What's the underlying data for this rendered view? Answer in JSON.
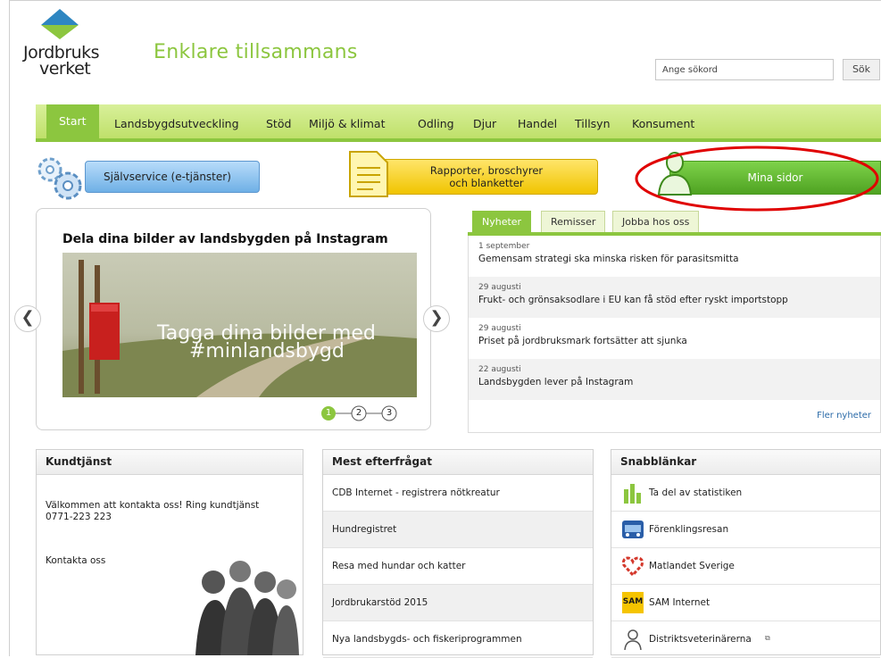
{
  "header": {
    "logo_line1": "Jordbruks",
    "logo_line2": "verket",
    "tagline": "Enklare tillsammans",
    "search_placeholder": "Ange sökord",
    "search_button": "Sök"
  },
  "nav": {
    "items": [
      "Start",
      "Landsbygdsutveckling",
      "Stöd",
      "Miljö & klimat",
      "Odling",
      "Djur",
      "Handel",
      "Tillsyn",
      "Konsument"
    ]
  },
  "quicklinks": {
    "selfservice": "Självservice (e-tjänster)",
    "reports_line1": "Rapporter, broschyrer",
    "reports_line2": "och blanketter",
    "my_pages": "Mina sidor"
  },
  "carousel": {
    "title": "Dela dina bilder av landsbygden på Instagram",
    "caption_line1": "Tagga dina bilder med",
    "caption_line2": "#minlandsbygd",
    "pages": [
      "1",
      "2",
      "3"
    ],
    "current_page": 1
  },
  "news": {
    "tabs": [
      "Nyheter",
      "Remisser",
      "Jobba hos oss"
    ],
    "items": [
      {
        "date": "1 september",
        "text": "Gemensam strategi ska minska risken för parasitsmitta"
      },
      {
        "date": "29 augusti",
        "text": "Frukt- och grönsaksodlare i EU kan få stöd efter ryskt importstopp"
      },
      {
        "date": "29 augusti",
        "text": "Priset på jordbruksmark fortsätter att sjunka"
      },
      {
        "date": "22 augusti",
        "text": "Landsbygden lever på Instagram"
      }
    ],
    "more": "Fler nyheter"
  },
  "kundtjanst": {
    "title": "Kundtjänst",
    "welcome_line1": "Välkommen att kontakta oss! Ring kundtjänst",
    "welcome_line2": "0771-223 223",
    "contact": "Kontakta oss"
  },
  "mest": {
    "title": "Mest efterfrågat",
    "items": [
      "CDB Internet - registrera nötkreatur",
      "Hundregistret",
      "Resa med hundar och katter",
      "Jordbrukarstöd 2015",
      "Nya landsbygds- och fiskeriprogrammen"
    ]
  },
  "snabb": {
    "title": "Snabblänkar",
    "items": [
      {
        "label": "Ta del av statistiken",
        "icon": "bar-chart-icon"
      },
      {
        "label": "Förenklingsresan",
        "icon": "bus-icon"
      },
      {
        "label": "Matlandet Sverige",
        "icon": "heart-icon"
      },
      {
        "label": "SAM Internet",
        "icon": "sam-icon",
        "badge": "SAM"
      },
      {
        "label": "Distriktsveterinärerna",
        "icon": "vet-icon"
      }
    ]
  },
  "colors": {
    "accent_green": "#8cc63f",
    "highlight_red": "#e00000"
  }
}
